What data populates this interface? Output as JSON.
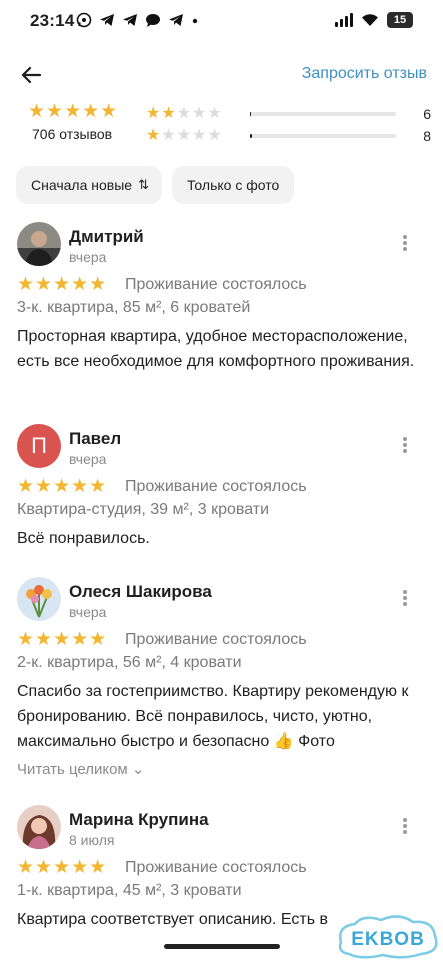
{
  "status_bar": {
    "time": "23:14",
    "notification_icons": [
      "whatsapp-icon",
      "telegram-icon",
      "telegram-icon",
      "chat-bubble-icon",
      "telegram-icon",
      "dot-icon"
    ],
    "battery": "15"
  },
  "header": {
    "request_review": "Запросить отзыв"
  },
  "summary": {
    "stars": "★★★★★",
    "reviews_count": "706 отзывов",
    "distribution": [
      {
        "stars": 2,
        "count": "6",
        "fraction": 0.01
      },
      {
        "stars": 1,
        "count": "8",
        "fraction": 0.011
      }
    ]
  },
  "filters": {
    "sort": "Сначала новые",
    "sort_icon": "⇅",
    "photo_only": "Только с фото"
  },
  "reviews": [
    {
      "name": "Дмитрий",
      "date": "вчера",
      "stars": "★★★★★",
      "status": "Проживание состоялось",
      "apartment": "3-к. квартира, 85 м², 6 кроватей",
      "text": "Просторная квартира, удобное месторасположение, есть все необходимое для комфортного проживания."
    },
    {
      "name": "Павел",
      "avatar_letter": "П",
      "date": "вчера",
      "stars": "★★★★★",
      "status": "Проживание состоялось",
      "apartment": "Квартира-студия, 39 м², 3 кровати",
      "text": "Всё понравилось."
    },
    {
      "name": "Олеся Шакирова",
      "date": "вчера",
      "stars": "★★★★★",
      "status": "Проживание состоялось",
      "apartment": "2-к. квартира, 56 м², 4 кровати",
      "text": "Спасибо за гостеприимство. Квартиру рекомендую к бронированию. Всё понравилось, чисто, уютно, максимально быстро и безопасно 👍 Фото",
      "read_more": "Читать целиком ⌄"
    },
    {
      "name": "Марина Крупина",
      "date": "8 июля",
      "stars": "★★★★★",
      "status": "Проживание состоялось",
      "apartment": "1-к. квартира, 45 м², 3 кровати",
      "text": "Квартира соответствует описанию. Есть в"
    }
  ],
  "watermark": "EKBOB",
  "colors": {
    "star": "#f2b632",
    "link": "#3e8fc5",
    "avatar_pavel": "#d9534f"
  }
}
